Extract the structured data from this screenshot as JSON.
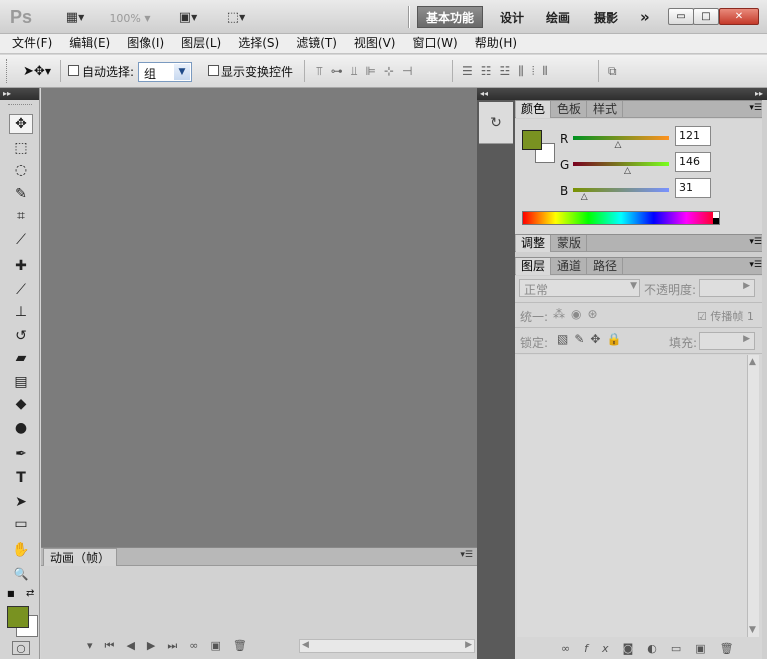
{
  "title_bar": {
    "logo": "Ps",
    "zoom": "100%",
    "workspaces": [
      "基本功能",
      "设计",
      "绘画",
      "摄影"
    ],
    "more": "»",
    "window_buttons": {
      "minimize": "▭",
      "maximize": "□",
      "close": "✕"
    }
  },
  "menu": [
    "文件(F)",
    "编辑(E)",
    "图像(I)",
    "图层(L)",
    "选择(S)",
    "滤镜(T)",
    "视图(V)",
    "窗口(W)",
    "帮助(H)"
  ],
  "options": {
    "auto_select_label": "自动选择:",
    "auto_select_value": "组",
    "auto_select_checked": false,
    "show_transform_label": "显示变换控件",
    "show_transform_checked": false
  },
  "tools": [
    {
      "name": "move-tool",
      "glyph": "✥",
      "selected": true
    },
    {
      "name": "marquee-tool",
      "glyph": "⬚"
    },
    {
      "name": "lasso-tool",
      "glyph": "◌"
    },
    {
      "name": "quick-select-tool",
      "glyph": "✎"
    },
    {
      "name": "crop-tool",
      "glyph": "⌗"
    },
    {
      "name": "eyedropper-tool",
      "glyph": "⟋"
    },
    {
      "name": "healing-brush-tool",
      "glyph": "✚"
    },
    {
      "name": "brush-tool",
      "glyph": "⟋"
    },
    {
      "name": "clone-stamp-tool",
      "glyph": "⊥"
    },
    {
      "name": "history-brush-tool",
      "glyph": "↺"
    },
    {
      "name": "eraser-tool",
      "glyph": "▰"
    },
    {
      "name": "gradient-tool",
      "glyph": "▤"
    },
    {
      "name": "blur-tool",
      "glyph": "◆"
    },
    {
      "name": "dodge-tool",
      "glyph": "●"
    },
    {
      "name": "pen-tool",
      "glyph": "✒"
    },
    {
      "name": "type-tool",
      "glyph": "T"
    },
    {
      "name": "path-select-tool",
      "glyph": "➤"
    },
    {
      "name": "shape-tool",
      "glyph": "▭"
    },
    {
      "name": "hand-tool",
      "glyph": "✋"
    },
    {
      "name": "zoom-tool",
      "glyph": "🔍"
    }
  ],
  "colors": {
    "foreground": "#799221",
    "background": "#ffffff",
    "canvas_bg": "#7c7c7c"
  },
  "animation_panel": {
    "tab": "动画（帧）"
  },
  "color_panel": {
    "tabs": [
      "颜色",
      "色板",
      "样式"
    ],
    "channels": [
      {
        "label": "R",
        "value": "121",
        "fraction": 0.474
      },
      {
        "label": "G",
        "value": "146",
        "fraction": 0.573
      },
      {
        "label": "B",
        "value": "31",
        "fraction": 0.122
      }
    ]
  },
  "adjust_panel": {
    "tabs": [
      "调整",
      "蒙版"
    ]
  },
  "layers_panel": {
    "tabs": [
      "图层",
      "通道",
      "路径"
    ],
    "blend_mode": "正常",
    "opacity_label": "不透明度:",
    "unify_label": "统一:",
    "propagate_label": "传播帧 1",
    "lock_label": "锁定:",
    "fill_label": "填充:"
  }
}
